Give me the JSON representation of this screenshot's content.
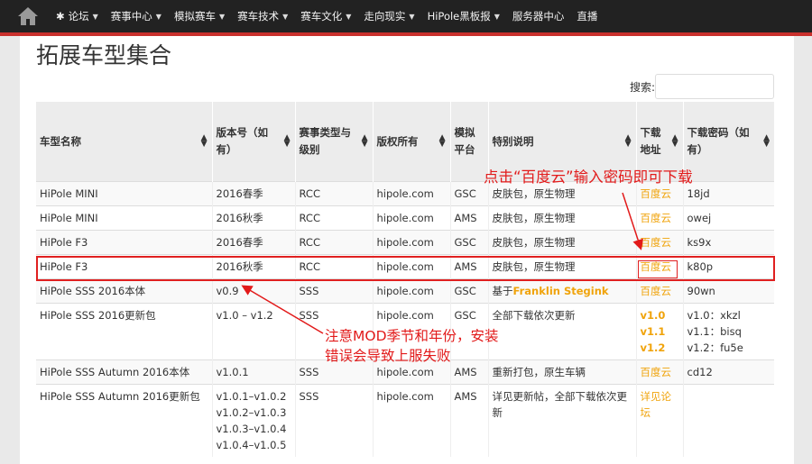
{
  "nav": {
    "items": [
      {
        "label": "论坛",
        "has_icon": true
      },
      {
        "label": "赛事中心"
      },
      {
        "label": "模拟赛车"
      },
      {
        "label": "赛车技术"
      },
      {
        "label": "赛车文化"
      },
      {
        "label": "走向现实"
      },
      {
        "label": "HiPole黑板报"
      },
      {
        "label": "服务器中心",
        "no_caret": true
      },
      {
        "label": "直播",
        "no_caret": true
      }
    ],
    "accent_color": "#c9302c",
    "home_icon": "home-icon"
  },
  "page": {
    "title": "拓展车型集合",
    "search_label": "搜索:"
  },
  "table": {
    "headers": [
      "车型名称",
      "版本号（如有）",
      "赛事类型与级别",
      "版权所有",
      "模拟平台",
      "特别说明",
      "下载地址",
      "下载密码（如有）"
    ],
    "rows": [
      {
        "name": "HiPole MINI",
        "version": "2016春季",
        "type": "RCC",
        "owner": "hipole.com",
        "platform": "GSC",
        "note": "皮肤包，原生物理",
        "download": "百度云",
        "password": "18jd"
      },
      {
        "name": "HiPole MINI",
        "version": "2016秋季",
        "type": "RCC",
        "owner": "hipole.com",
        "platform": "AMS",
        "note": "皮肤包，原生物理",
        "download": "百度云",
        "password": "owej"
      },
      {
        "name": "HiPole F3",
        "version": "2016春季",
        "type": "RCC",
        "owner": "hipole.com",
        "platform": "GSC",
        "note": "皮肤包，原生物理",
        "download": "百度云",
        "password": "ks9x"
      },
      {
        "name": "HiPole F3",
        "version": "2016秋季",
        "type": "RCC",
        "owner": "hipole.com",
        "platform": "AMS",
        "note": "皮肤包，原生物理",
        "download": "百度云",
        "password": "k80p"
      },
      {
        "name": "HiPole SSS 2016本体",
        "version": "v0.9",
        "type": "SSS",
        "owner": "hipole.com",
        "platform": "GSC",
        "note_prefix": "基于",
        "note_link": "Franklin Stegink",
        "download": "百度云",
        "password": "90wn"
      },
      {
        "name": "HiPole SSS 2016更新包",
        "version": "v1.0 – v1.2",
        "type": "SSS",
        "owner": "hipole.com",
        "platform": "GSC",
        "note": "全部下载依次更新",
        "downloads": [
          "v1.0",
          "v1.1",
          "v1.2"
        ],
        "passwords": [
          "v1.0：xkzl",
          "v1.1：bisq",
          "v1.2：fu5e"
        ]
      },
      {
        "name": "HiPole SSS Autumn 2016本体",
        "version": "v1.0.1",
        "type": "SSS",
        "owner": "hipole.com",
        "platform": "AMS",
        "note": "重新打包，原生车辆",
        "download": "百度云",
        "password": "cd12"
      },
      {
        "name": "HiPole SSS Autumn 2016更新包",
        "versions": [
          "v1.0.1–v1.0.2",
          "v1.0.2–v1.0.3",
          "v1.0.3–v1.0.4",
          "v1.0.4–v1.0.5"
        ],
        "type": "SSS",
        "owner": "hipole.com",
        "platform": "AMS",
        "note": "详见更新帖，全部下载依次更新",
        "download": "详见论坛",
        "password": ""
      }
    ]
  },
  "annotations": {
    "note1": "点击“百度云”输入密码即可下载",
    "note2": "注意MOD季节和年份，安装错误会导致上服失败",
    "color": "#e21a1a"
  }
}
